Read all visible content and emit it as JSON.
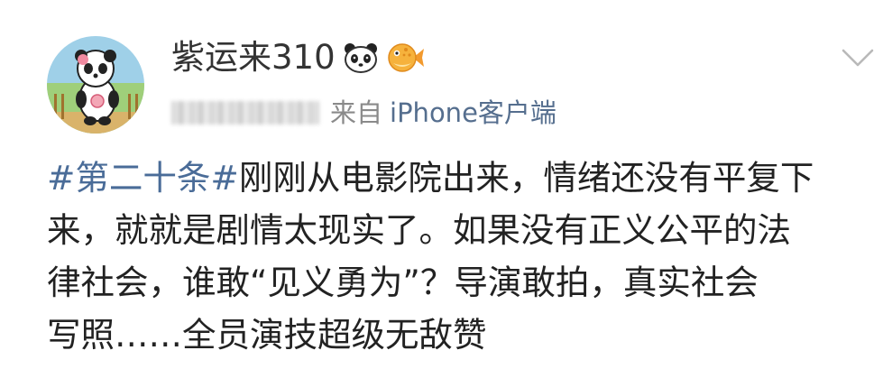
{
  "post": {
    "username": "紫运来310",
    "source_prefix": "来自",
    "source_name": "iPhone客户端",
    "hashtag": "#第二十条#",
    "text_lines": [
      "刚刚从电影院出来，情绪还没有平复下",
      "来，就就是剧情太现实了。如果没有正义公平的法",
      "律社会，谁敢“见义勇为”？导演敢拍，真实社会",
      "写照……全员演技超级无敌赞"
    ]
  },
  "icons": {
    "avatar": "panda-avatar",
    "badge_1": "panda-icon",
    "badge_2": "pufferfish-icon",
    "menu": "chevron-down-icon"
  },
  "colors": {
    "hashtag": "#4a6c98",
    "source_link": "#556e8e",
    "text": "#222222",
    "meta": "#8a8a8a"
  }
}
